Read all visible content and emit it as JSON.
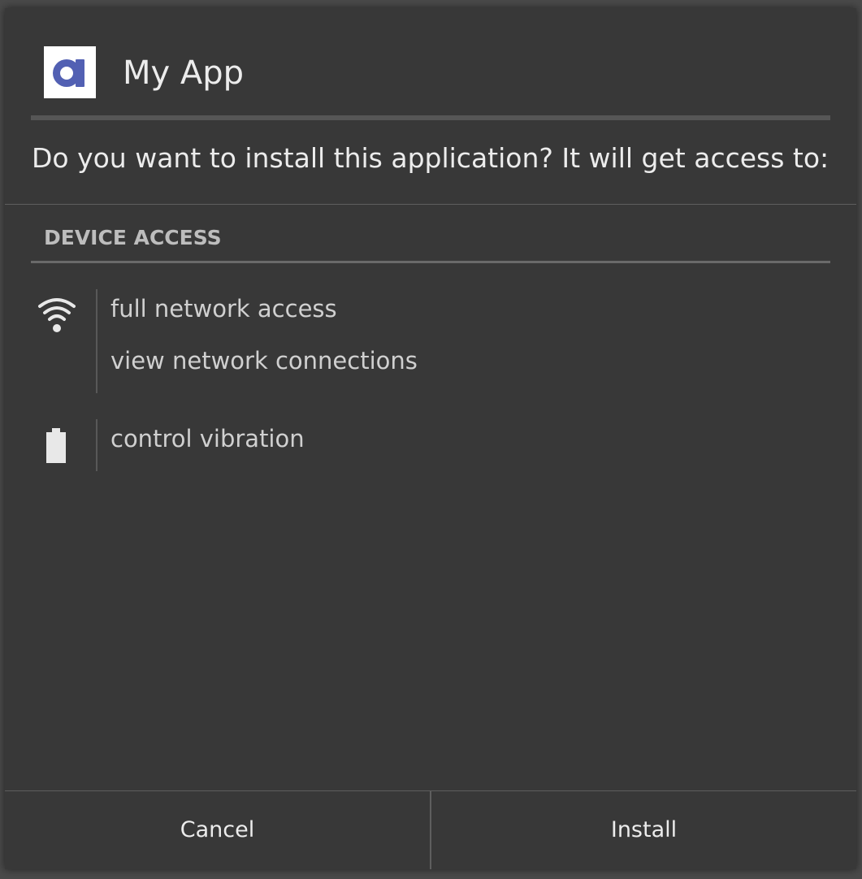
{
  "dialog": {
    "app_name": "My App",
    "app_icon": "app-logo-letter-a",
    "prompt": "Do you want to install this application? It will get access to:"
  },
  "permissions": {
    "section_title": "DEVICE ACCESS",
    "groups": [
      {
        "icon": "wifi-icon",
        "items": [
          "full network access",
          "view network connections"
        ]
      },
      {
        "icon": "battery-icon",
        "items": [
          "control vibration"
        ]
      }
    ]
  },
  "buttons": {
    "cancel_label": "Cancel",
    "install_label": "Install"
  },
  "colors": {
    "dialog_background": "#383838",
    "app_icon_accent": "#5260b3",
    "text_primary": "#ececec",
    "text_secondary": "#d0d0d0"
  }
}
